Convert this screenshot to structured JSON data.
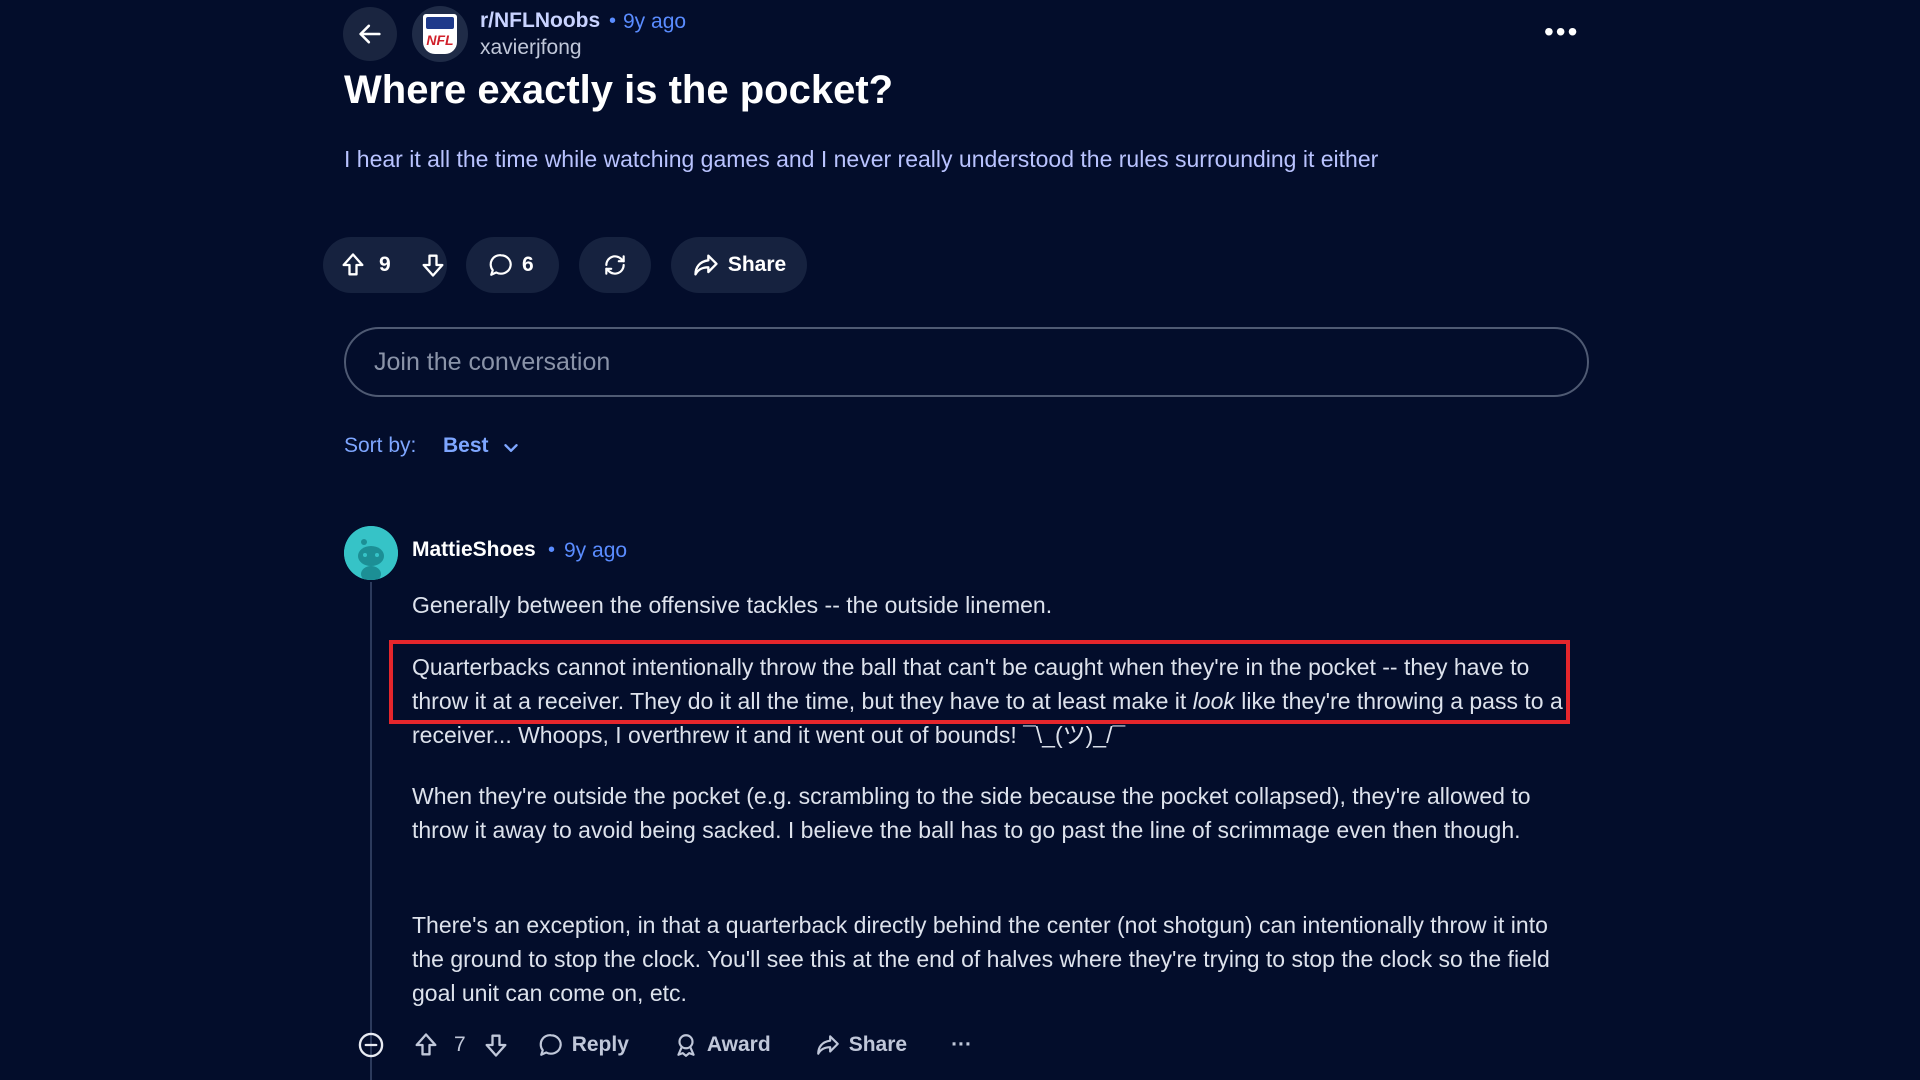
{
  "header": {
    "subreddit": "r/NFLNoobs",
    "separator": "•",
    "age": "9y ago",
    "author": "xavierjfong",
    "subreddit_logo_text": "NFL",
    "more_label": "•••"
  },
  "post": {
    "title": "Where exactly is the pocket?",
    "body": "I hear it all the time while watching games and I never really understood the rules surrounding it either",
    "score": "9",
    "comment_count": "6",
    "share_label": "Share"
  },
  "composer": {
    "placeholder": "Join the conversation"
  },
  "sort": {
    "label": "Sort by:",
    "value": "Best"
  },
  "comment": {
    "author": "MattieShoes",
    "separator": "•",
    "age": "9y ago",
    "paragraphs": {
      "p1": "Generally between the offensive tackles -- the outside linemen.",
      "p2_before": "Quarterbacks cannot intentionally throw the ball that can't be caught when they're in the pocket -- they have to throw it at a receiver. They do it all the time, but they have to at least make it ",
      "p2_italic": "look",
      "p2_after": " like they're throwing a pass to a receiver... Whoops, I overthrew it and it went out of bounds! ¯\\_(ツ)_/¯",
      "p3": "When they're outside the pocket (e.g. scrambling to the side because the pocket collapsed), they're allowed to throw it away to avoid being sacked. I believe the ball has to go past the line of scrimmage even then though.",
      "p4": "There's an exception, in that a quarterback directly behind the center (not shotgun) can intentionally throw it into the ground to stop the clock. You'll see this at the end of halves where they're trying to stop the clock so the field goal unit can come on, etc."
    },
    "score": "7",
    "reply_label": "Reply",
    "award_label": "Award",
    "share_label": "Share",
    "more_label": "···"
  },
  "colors": {
    "background": "#030d2b",
    "accent_blue": "#5a8cff",
    "highlight_box": "#e5262c"
  },
  "icons": [
    "arrow-left-icon",
    "upvote-icon",
    "downvote-icon",
    "comment-icon",
    "crosspost-icon",
    "share-icon",
    "chevron-down-icon",
    "collapse-icon",
    "award-icon",
    "more-icon"
  ]
}
